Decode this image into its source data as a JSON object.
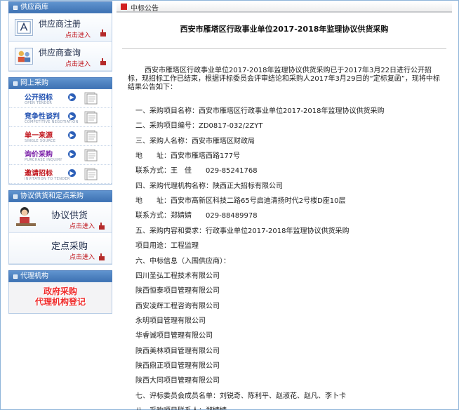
{
  "sidebar": {
    "supplier": {
      "header": "供应商库",
      "register": {
        "title": "供应商注册",
        "enter": "点击进入"
      },
      "query": {
        "title": "供应商查询",
        "enter": "点击进入"
      }
    },
    "online": {
      "header": "网上采购",
      "items": [
        {
          "cn": "公开招标",
          "en": "OPEN TENDER",
          "color": "#1f4fb0"
        },
        {
          "cn": "竞争性谈判",
          "en": "COMPETITIVE NEGOTIATION",
          "color": "#1f4fb0"
        },
        {
          "cn": "单一来源",
          "en": "SINGLE SOURCE",
          "color": "#c0141b"
        },
        {
          "cn": "询价采购",
          "en": "PURCHASE INQUIRY",
          "color": "#7a1fa8"
        },
        {
          "cn": "邀请招标",
          "en": "INVITATION TO TENDER",
          "color": "#c0141b"
        }
      ]
    },
    "agreement": {
      "header": "协议供货和定点采购",
      "items": [
        {
          "title": "协议供货",
          "enter": "点击进入"
        },
        {
          "title": "定点采购",
          "enter": "点击进入"
        }
      ]
    },
    "agency": {
      "header": "代理机构",
      "banner_line1": "政府采购",
      "banner_line2": "代理机构登记"
    }
  },
  "main": {
    "section_label": "中标公告",
    "title": "西安市雁塔区行政事业单位2017-2018年监理协议供货采购",
    "intro": "西安市雁塔区行政事业单位2017-2018年监理协议供货采购已于2017年3月22日进行公开招标，现招标工作已结束，根据评标委员会评审结论和采购人2017年3月29日的“定标复函”，现将中标结果公告如下：",
    "lines": [
      "一、采购项目名称：西安市雁塔区行政事业单位2017-2018年监理协议供货采购",
      "二、采购项目编号：ZD0817-032/2ZYT",
      "三、采购人名称：西安市雁塔区财政局",
      "地　　址：西安市雁塔西路177号",
      "联系方式：王　佳　　029-85241768",
      "四、采购代理机构名称：陕西正大招标有限公司",
      "地　　址：西安市高新区科技二路65号启迪清扬时代2号楼D座10层",
      "联系方式：郑婧婧　　029-88489978",
      "五、采购内容和要求：行政事业单位2017-2018年监理协议供货采购",
      "项目用途：工程监理",
      "六、中标信息（入围供应商）：",
      "四川圣弘工程技术有限公司",
      "陕西恒泰项目管理有限公司",
      "西安凌辉工程咨询有限公司",
      "永明项目管理有限公司",
      "华睿诚项目管理有限公司",
      "陕西美林项目管理有限公司",
      "陕西鼎正项目管理有限公司",
      "陕西大同项目管理有限公司",
      "七、评标委员会成员名单：刘锐奇、陈利平、赵淑花、赵凡、李卜卡",
      "八、采购项目联系人：郑婧婧"
    ]
  }
}
